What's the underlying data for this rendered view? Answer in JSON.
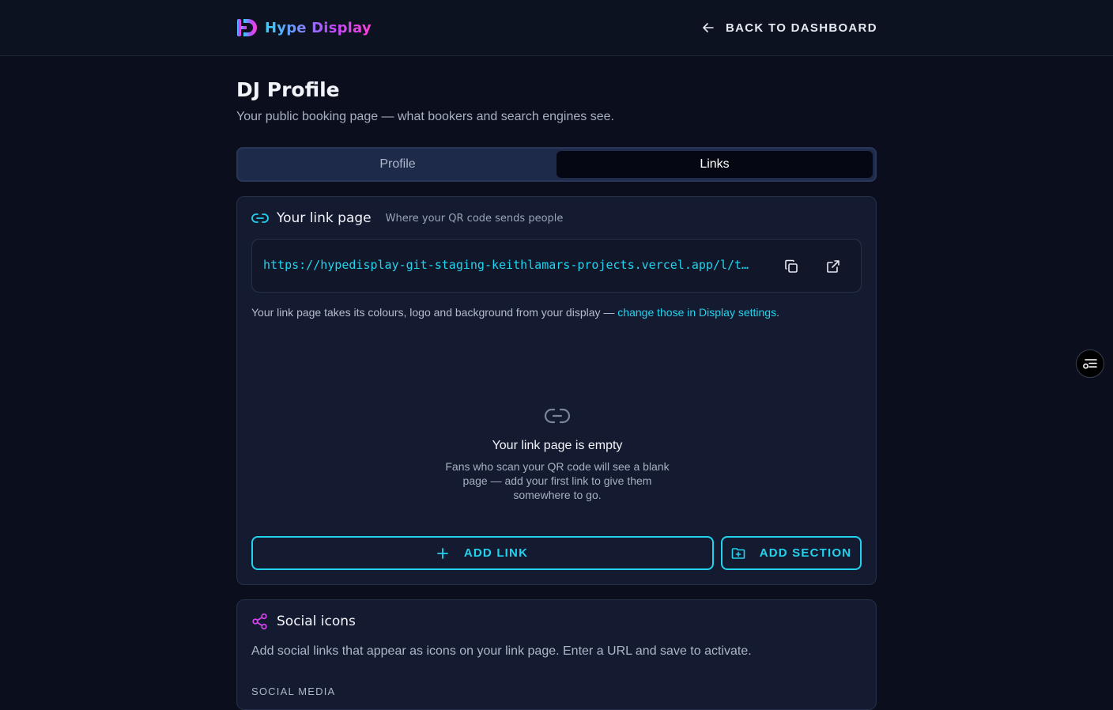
{
  "header": {
    "brand_name": "Hype Display",
    "back_label": "BACK TO DASHBOARD"
  },
  "page": {
    "title": "DJ Profile",
    "subtitle": "Your public booking page — what bookers and search engines see."
  },
  "tabs": [
    {
      "label": "Profile",
      "active": false
    },
    {
      "label": "Links",
      "active": true
    }
  ],
  "link_card": {
    "title": "Your link page",
    "hint": "Where your QR code sends people",
    "url": "https://hypedisplay-git-staging-keithlamars-projects.vercel.app/l/t…",
    "note_prefix": "Your link page takes its colours, logo and background from your display — ",
    "note_link": "change those in Display settings",
    "note_suffix": ".",
    "empty_title": "Your link page is empty",
    "empty_desc": "Fans who scan your QR code will see a blank page — add your first link to give them somewhere to go.",
    "add_link_label": "ADD LINK",
    "add_section_label": "ADD SECTION"
  },
  "social_card": {
    "title": "Social icons",
    "subtitle": "Add social links that appear as icons on your link page. Enter a URL and save to activate.",
    "section_label": "SOCIAL MEDIA"
  },
  "colors": {
    "accent": "#22d3ee",
    "social_icon": "#d946ef",
    "background": "#0b0f1d",
    "card": "#141b30"
  },
  "icons": {
    "back": "arrow-left-icon",
    "copy": "copy-icon",
    "open": "external-link-icon",
    "link": "link-icon",
    "share": "share-icon",
    "plus": "plus-icon",
    "folder": "folder-plus-icon",
    "fab": "settings-list-icon"
  }
}
